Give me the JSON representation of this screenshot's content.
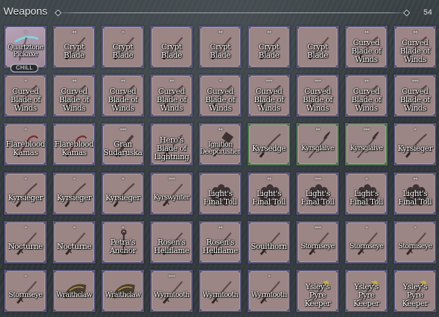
{
  "header": {
    "title": "Weapons",
    "count": "54"
  },
  "tag": {
    "label": "CHILL"
  },
  "items": [
    {
      "stars": "*",
      "name": "Quartztone Pickaxe",
      "art": "pickaxe",
      "small": true
    },
    {
      "stars": "**",
      "name": "Crypt Blade",
      "art": "sword"
    },
    {
      "stars": "*",
      "name": "Crypt Blade",
      "art": "sword"
    },
    {
      "stars": "",
      "name": "Crypt Blade",
      "art": "sword"
    },
    {
      "stars": "**",
      "name": "Crypt Blade",
      "art": "sword"
    },
    {
      "stars": "**",
      "name": "Crypt Blade",
      "art": "sword"
    },
    {
      "stars": "",
      "name": "Crypt Blade",
      "art": "sword"
    },
    {
      "stars": "**",
      "name": "Curved Blade of Winds",
      "art": "curved"
    },
    {
      "stars": "**",
      "name": "Curved Blade of Winds",
      "art": "curved"
    },
    {
      "stars": "*",
      "name": "Curved Blade of Winds",
      "art": "curved"
    },
    {
      "stars": "**",
      "name": "Curved Blade of Winds",
      "art": "curved"
    },
    {
      "stars": "**",
      "name": "Curved Blade of Winds",
      "art": "curved"
    },
    {
      "stars": "**",
      "name": "Curved Blade of Winds",
      "art": "curved"
    },
    {
      "stars": "*",
      "name": "Curved Blade of Winds",
      "art": "curved"
    },
    {
      "stars": "***",
      "name": "Curved Blade of Winds",
      "art": "curved"
    },
    {
      "stars": "***",
      "name": "Curved Blade of Winds",
      "art": "curved"
    },
    {
      "stars": "**",
      "name": "Curved Blade of Winds",
      "art": "curved"
    },
    {
      "stars": "***",
      "name": "Curved Blade of Winds",
      "art": "curved"
    },
    {
      "stars": "*",
      "name": "Flareblood Kamas",
      "art": "kama"
    },
    {
      "stars": "",
      "name": "Flareblood Kamas",
      "art": "kama"
    },
    {
      "stars": "***",
      "name": "Gran Sudaruska",
      "art": "greatsword"
    },
    {
      "stars": "",
      "name": "Hero's Blade of Lightning",
      "art": "sword"
    },
    {
      "stars": "**",
      "name": "Ignition Deepcrusher",
      "art": "hammer",
      "small": true
    },
    {
      "stars": "",
      "name": "Kyrsedge",
      "art": "curved",
      "hl": true
    },
    {
      "stars": "**",
      "name": "Kyrsglaive",
      "art": "glaive",
      "hl": true,
      "small": true
    },
    {
      "stars": "***",
      "name": "Kyrsglaive",
      "art": "glaive",
      "hl": true,
      "small": true
    },
    {
      "stars": "*",
      "name": "Kyrsieger",
      "art": "curved"
    },
    {
      "stars": "*",
      "name": "Kyrsieger",
      "art": "curved"
    },
    {
      "stars": "*",
      "name": "Kyrsieger",
      "art": "curved"
    },
    {
      "stars": "*",
      "name": "Kyrsieger",
      "art": "curved"
    },
    {
      "stars": "***",
      "name": "Kyrswynter",
      "art": "sword",
      "small": true
    },
    {
      "stars": "",
      "name": "Light's Final Toll",
      "art": "toll"
    },
    {
      "stars": "**",
      "name": "Light's Final Toll",
      "art": "toll"
    },
    {
      "stars": "***",
      "name": "Light's Final Toll",
      "art": "toll"
    },
    {
      "stars": "*",
      "name": "Light's Final Toll",
      "art": "toll"
    },
    {
      "stars": "**",
      "name": "Light's Final Toll",
      "art": "toll"
    },
    {
      "stars": "*",
      "name": "Nocturne",
      "art": "sword"
    },
    {
      "stars": "*",
      "name": "Nocturne",
      "art": "sword"
    },
    {
      "stars": "*",
      "name": "Petra's Anchor",
      "art": "anchor"
    },
    {
      "stars": "",
      "name": "Rosen's Hellflame",
      "art": "sword"
    },
    {
      "stars": "**",
      "name": "Rosen's Hellflame",
      "art": "sword"
    },
    {
      "stars": "",
      "name": "Soulthorn",
      "art": "sword"
    },
    {
      "stars": "***",
      "name": "Stormseye",
      "art": "sword",
      "small": true
    },
    {
      "stars": "*",
      "name": "Stormseye",
      "art": "sword",
      "small": true
    },
    {
      "stars": "*",
      "name": "Stormseye",
      "art": "sword",
      "small": true
    },
    {
      "stars": "*",
      "name": "Stormseye",
      "art": "sword",
      "small": true
    },
    {
      "stars": "",
      "name": "Wraithclaw",
      "art": "claw",
      "small": true
    },
    {
      "stars": "",
      "name": "Wraithclaw",
      "art": "claw",
      "small": true
    },
    {
      "stars": "***",
      "name": "Wyrmtooth",
      "art": "sword",
      "small": true
    },
    {
      "stars": "",
      "name": "Wyrmtooth",
      "art": "sword",
      "small": true
    },
    {
      "stars": "*",
      "name": "Wyrmtooth",
      "art": "sword",
      "small": true
    },
    {
      "stars": "",
      "name": "Ysley's Pyre Keeper",
      "art": "staff"
    },
    {
      "stars": "",
      "name": "Ysley's Pyre Keeper",
      "art": "staff"
    },
    {
      "stars": "",
      "name": "Ysley's Pyre Keeper",
      "art": "staff"
    }
  ]
}
